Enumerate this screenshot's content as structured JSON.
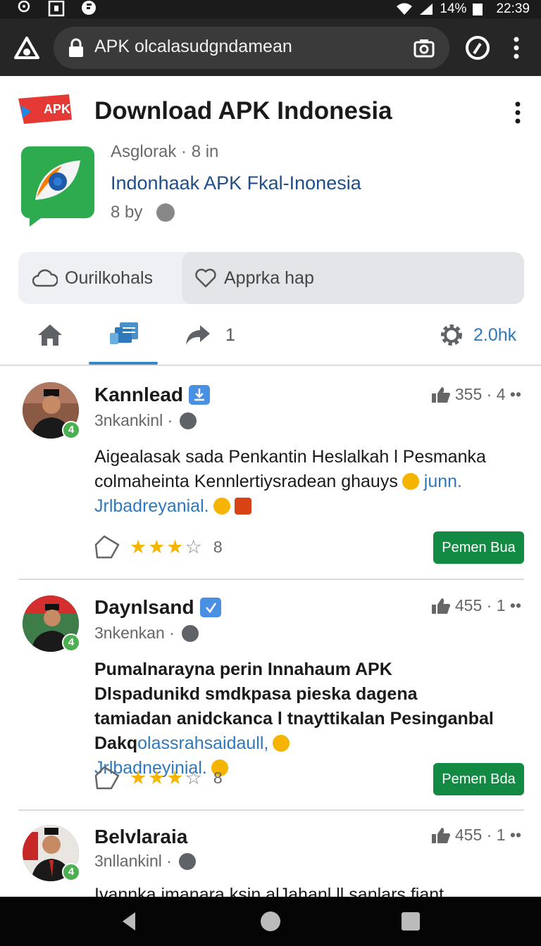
{
  "status_bar": {
    "battery": "14%",
    "time": "22:39"
  },
  "browser": {
    "url": "APK olcalasudgndamean"
  },
  "header": {
    "title": "Download APK Indonesia",
    "logo_text": "APK"
  },
  "app": {
    "meta": "Asglorak · 8 in",
    "name": "Indonhaak APK Fkal-Inonesia",
    "by": "8 by"
  },
  "actions": {
    "left_label": "Ourilkohals",
    "right_label": "Apprka hap"
  },
  "tabs": {
    "share_count": "1",
    "stat": "2.0hk"
  },
  "posts": [
    {
      "name": "Kannlead",
      "sub": "3nkankinl ·",
      "likes": "355 · 4 ••",
      "body_text": "Aigealasak sada Penkantin Heslalkah l Pesmanka colmaheinta Kennlertiysradean ghauys",
      "body_link1": "junn.",
      "body_link2": "Jrlbadreyanial.",
      "rating": "8",
      "cta": "Pemen Bua",
      "badge": "4"
    },
    {
      "name": "Daynlsand",
      "sub": "3nkenkan ·",
      "likes": "455 · 1 ••",
      "body_text": "Pumalnarayna perin Innahaum APK Dlspadunikd smdkpasa pieska dagena tamiadan anidckanca l tnayttikalan Pesinganbal Dakq",
      "body_link1": "olassrahsaidaull,",
      "body_link2": "Jrlbadneyinial.",
      "rating": "8",
      "cta": "Pemen Bda",
      "badge": "4"
    },
    {
      "name": "Belvlaraia",
      "sub": "3nllankinl ·",
      "likes": "455 · 1 ••",
      "body_text": "Ivannka imanara ksin alJahanl ll sanlars fiant..",
      "badge": "4"
    }
  ],
  "colors": {
    "accent": "#2f78bb",
    "cta": "#138a43",
    "star": "#f4b400",
    "verified": "#4a90e2",
    "apk_red": "#e53935",
    "app_green": "#2eab4f"
  }
}
